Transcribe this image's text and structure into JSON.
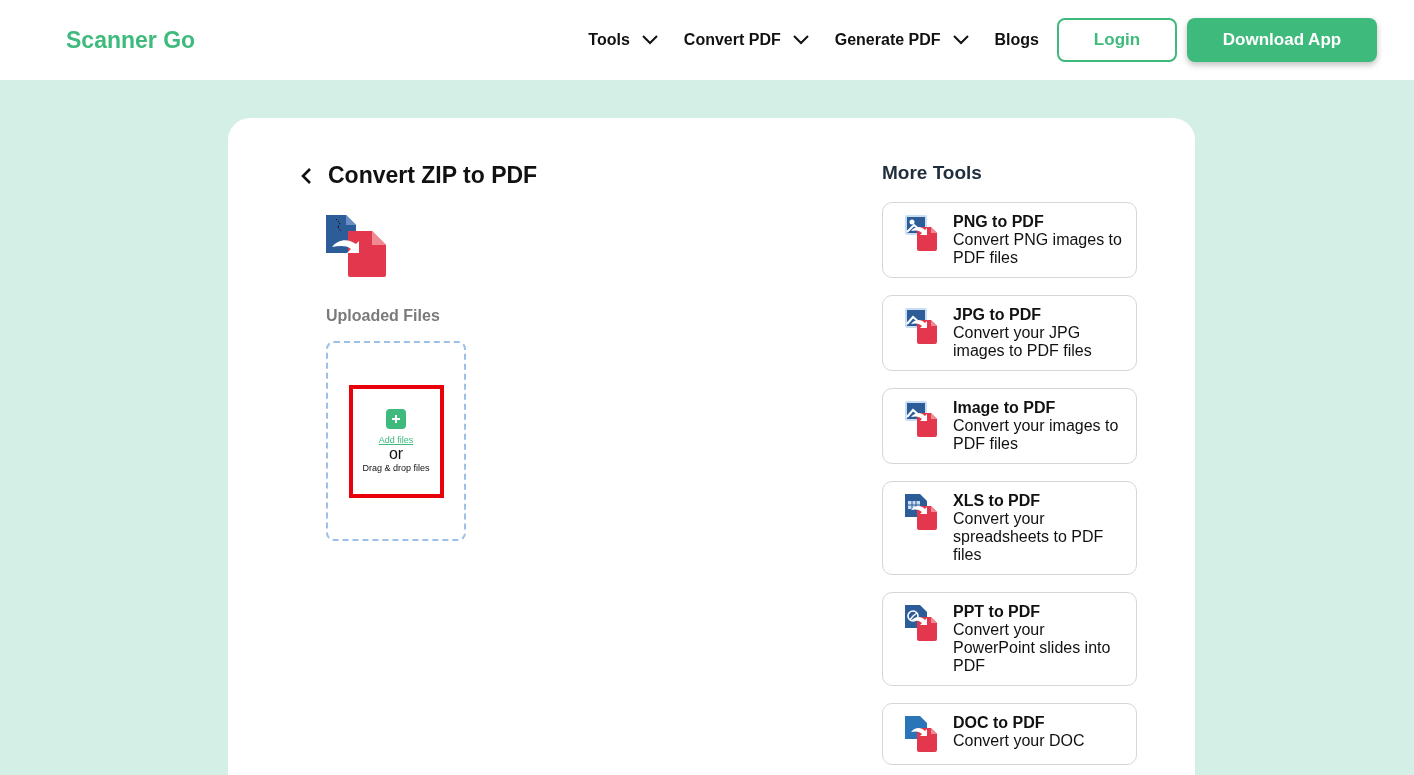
{
  "header": {
    "logo": "Scanner Go",
    "nav": [
      {
        "label": "Tools",
        "kind": "dropdown"
      },
      {
        "label": "Convert PDF",
        "kind": "dropdown"
      },
      {
        "label": "Generate PDF",
        "kind": "dropdown"
      },
      {
        "label": "Blogs",
        "kind": "link"
      }
    ],
    "login": "Login",
    "download": "Download App"
  },
  "main": {
    "title": "Convert ZIP to PDF",
    "uploaded_label": "Uploaded Files",
    "drop_zone": {
      "add": "Add files",
      "or": "or",
      "hint": "Drag & drop files",
      "highlighted": true
    }
  },
  "more_tools": {
    "heading": "More Tools",
    "items": [
      {
        "title": "PNG to PDF",
        "description": "Convert PNG images to PDF files",
        "kind": "photo"
      },
      {
        "title": "JPG to PDF",
        "description": "Convert your JPG images to PDF files",
        "kind": "image"
      },
      {
        "title": "Image to PDF",
        "description": "Convert your images to PDF files",
        "kind": "image"
      },
      {
        "title": "XLS to PDF",
        "description": "Convert your spreadsheets to PDF files",
        "kind": "sheet"
      },
      {
        "title": "PPT to PDF",
        "description": "Convert your PowerPoint slides into PDF",
        "kind": "slides"
      },
      {
        "title": "DOC to PDF",
        "description": "Convert your DOC",
        "kind": "document"
      }
    ]
  }
}
